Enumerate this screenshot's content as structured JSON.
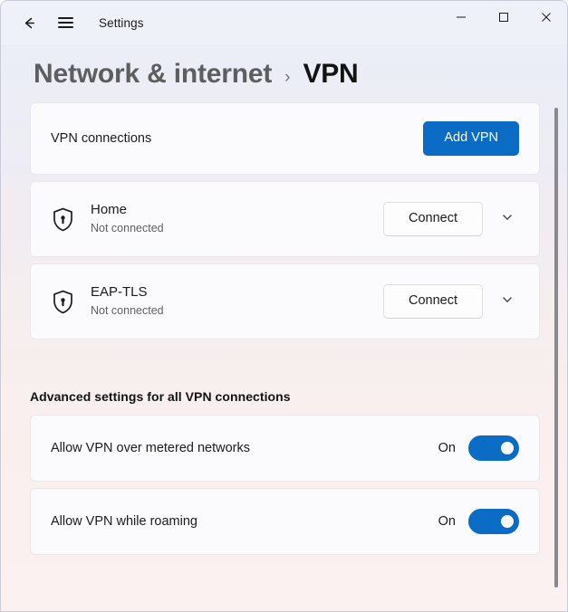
{
  "window": {
    "app_title": "Settings",
    "back_icon": "back-arrow-icon",
    "menu_icon": "hamburger-menu-icon",
    "controls": {
      "minimize": "minimize-icon",
      "maximize": "maximize-icon",
      "close": "close-icon"
    }
  },
  "breadcrumb": {
    "parent": "Network & internet",
    "separator": "›",
    "current": "VPN"
  },
  "vpn_connections_card": {
    "label": "VPN connections",
    "add_button": "Add VPN"
  },
  "connections": [
    {
      "icon": "shield-lock-icon",
      "name": "Home",
      "status": "Not connected",
      "connect_button": "Connect",
      "expand_icon": "chevron-down-icon"
    },
    {
      "icon": "shield-lock-icon",
      "name": "EAP-TLS",
      "status": "Not connected",
      "connect_button": "Connect",
      "expand_icon": "chevron-down-icon"
    }
  ],
  "advanced": {
    "title": "Advanced settings for all VPN connections",
    "settings": [
      {
        "label": "Allow VPN over metered networks",
        "state": "On"
      },
      {
        "label": "Allow VPN while roaming",
        "state": "On"
      }
    ]
  },
  "colors": {
    "accent": "#0a6cc4",
    "card_bg": "#fbfbfd",
    "text_primary": "#1b1b1b",
    "text_secondary": "#5f5f63",
    "titlebar_bg": "#eff1f8"
  }
}
